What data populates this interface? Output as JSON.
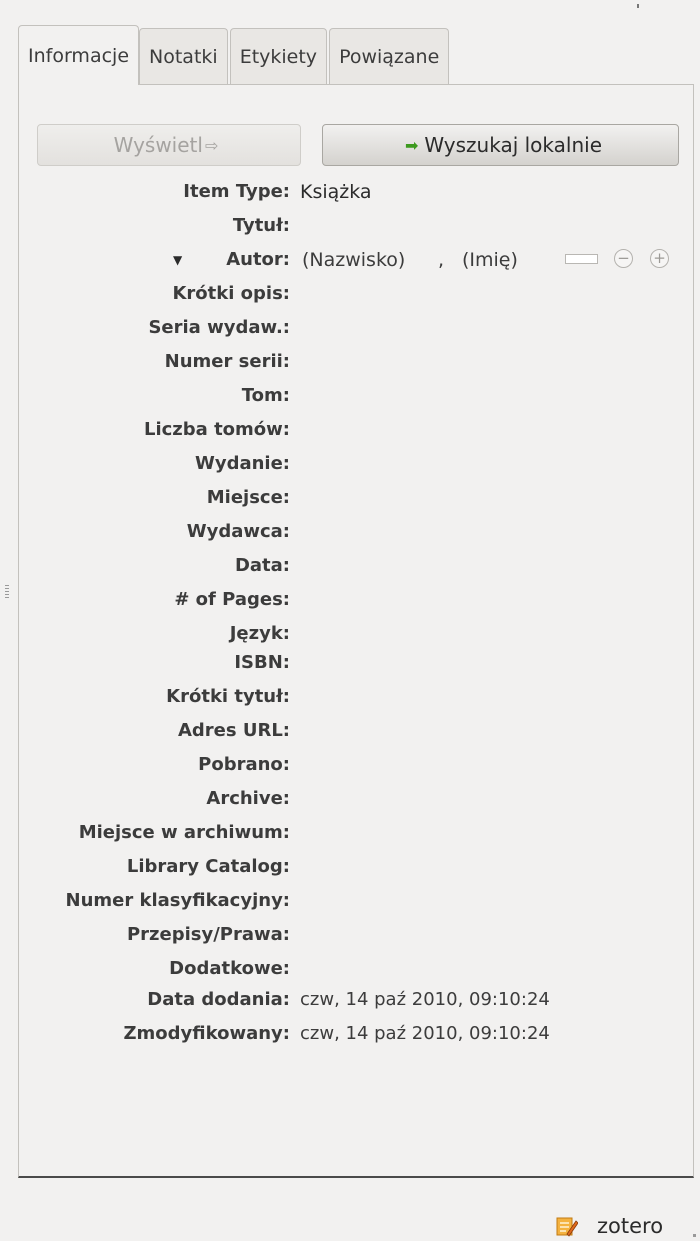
{
  "tabs": [
    {
      "label": "Informacje",
      "active": true
    },
    {
      "label": "Notatki",
      "active": false
    },
    {
      "label": "Etykiety",
      "active": false
    },
    {
      "label": "Powiązane",
      "active": false
    }
  ],
  "buttons": {
    "view_label": "Wyświetl",
    "search_label": "Wyszukaj lokalnie"
  },
  "item_type": {
    "label": "Item Type:",
    "value": "Książka"
  },
  "title": {
    "label": "Tytuł:"
  },
  "creator": {
    "label": "Autor:",
    "last_name_placeholder": "(Nazwisko)",
    "separator": ",",
    "first_name_placeholder": "(Imię)"
  },
  "fields": [
    "Krótki opis:",
    "Seria wydaw.:",
    "Numer serii:",
    "Tom:",
    "Liczba tomów:",
    "Wydanie:",
    "Miejsce:",
    "Wydawca:",
    "Data:",
    "# of Pages:",
    "Język:",
    "ISBN:",
    "Krótki tytuł:",
    "Adres URL:",
    "Pobrano:",
    "Archive:",
    "Miejsce w archiwum:",
    "Library Catalog:",
    "Numer klasyfikacyjny:",
    "Przepisy/Prawa:",
    "Dodatkowe:"
  ],
  "date_added": {
    "label": "Data dodania:",
    "value": "czw, 14 paź 2010, 09:10:24"
  },
  "date_modified": {
    "label": "Zmodyfikowany:",
    "value": "czw, 14 paź 2010, 09:10:24"
  },
  "status": {
    "app_name": "zotero",
    "icon": "zotero-pencil-icon"
  },
  "colors": {
    "accent_green": "#3d9a1f",
    "icon_orange": "#f0a030"
  }
}
